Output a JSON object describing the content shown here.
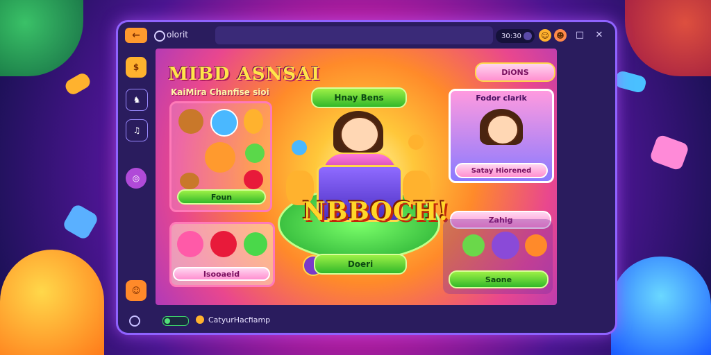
{
  "window": {
    "app_title": "olorit",
    "clock": "30:30",
    "back_icon": "arrow-left-icon"
  },
  "sidebar": {
    "items": [
      {
        "icon": "coin-icon",
        "label": "$"
      },
      {
        "icon": "cards-icon",
        "label": "♞"
      },
      {
        "icon": "book-icon",
        "label": "♫"
      },
      {
        "icon": "disc-icon",
        "label": "◎"
      },
      {
        "icon": "chest-icon",
        "label": "☺"
      }
    ]
  },
  "main": {
    "heading": "MIBD ASNSAI",
    "subheading": "KaiMira Chanfise sioi",
    "top_button": "Hnay Bens",
    "big_word": "NBBOCH!",
    "center_button": "Doeri",
    "left_panel_button": "Foun",
    "left_lower_button": "Isooaeid",
    "right_top_button": "DiONS",
    "right_card_title": "Fodor clarik",
    "right_card_caption": "Satay Hiorened",
    "right_mid_button": "Zahig",
    "right_bottom_button": "Saone"
  },
  "statusbar": {
    "text": "CatyurHacfiamp"
  },
  "colors": {
    "window_border": "#8f63ff",
    "green_button": "#32b82a",
    "pink_button": "#ff8fd0",
    "gold_text": "#ffd62a"
  }
}
